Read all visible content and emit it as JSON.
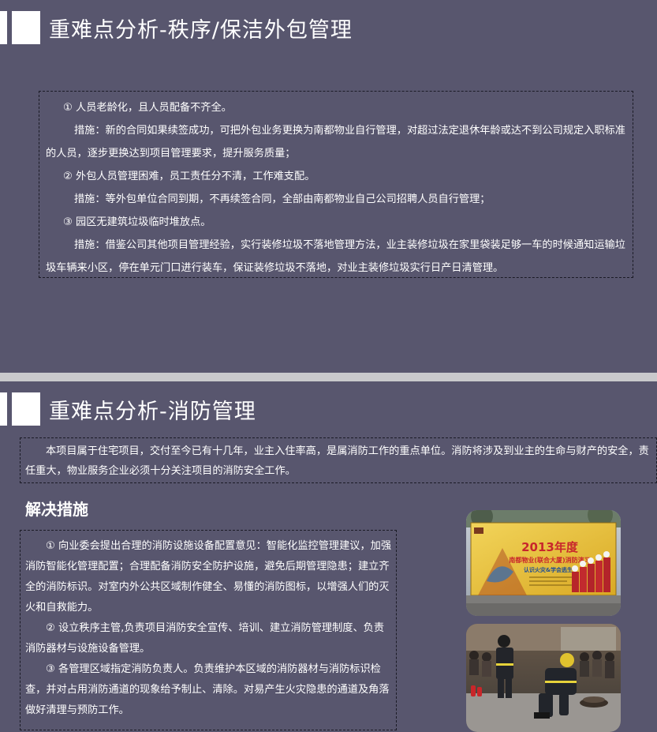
{
  "slide1": {
    "title": "重难点分析-秩序/保洁外包管理",
    "paragraphs": [
      "① 人员老龄化，且人员配备不齐全。",
      "措施：新的合同如果续签成功，可把外包业务更换为南都物业自行管理，对超过法定退休年龄或达不到公司规定入职标准的人员，逐步更换达到项目管理要求，提升服务质量；",
      "② 外包人员管理困难，员工责任分不清，工作难支配。",
      "措施：等外包单位合同到期，不再续签合同，全部由南都物业自己公司招聘人员自行管理；",
      "③ 园区无建筑垃圾临时堆放点。",
      "措施：借鉴公司其他项目管理经验，实行装修垃圾不落地管理方法，业主装修垃圾在家里袋装足够一车的时候通知运输垃圾车辆来小区，停在单元门口进行装车，保证装修垃圾不落地，对业主装修垃圾实行日产日清管理。"
    ]
  },
  "slide2": {
    "title": "重难点分析-消防管理",
    "intro": "本项目属于住宅项目，交付至今已有十几年，业主入住率高，是属消防工作的重点单位。消防将涉及到业主的生命与财产的安全，责任重大，物业服务企业必须十分关注项目的消防安全工作。",
    "subheading": "解决措施",
    "measures": [
      "① 向业委会提出合理的消防设施设备配置意见：智能化监控管理建议，加强消防智能化管理配置；合理配备消防安全防护设施，避免后期管理隐患；建立齐全的消防标识。对室内外公共区域制作健全、易懂的消防图标，以增强人们的灭火和自救能力。",
      "② 设立秩序主管,负责项目消防安全宣传、培训、建立消防管理制度、负责消防器材与设施设备管理。",
      "③ 各管理区域指定消防负责人。负责维护本区域的消防器材与消防标识检查，并对占用消防通道的现象给予制止、清除。对易产生火灾隐患的通道及角落做好清理与预防工作。"
    ],
    "photo_banner": {
      "year_text": "2013年度",
      "line1": "南都物业(联合大厦)消防演习",
      "line2": "认识火灾&学会逃生"
    }
  },
  "colors": {
    "slide_bg": "#58566e",
    "text": "#ffffff",
    "gap": "#c9c9cc",
    "banner_yellow": "#e9c02a",
    "banner_red": "#c8262c"
  }
}
